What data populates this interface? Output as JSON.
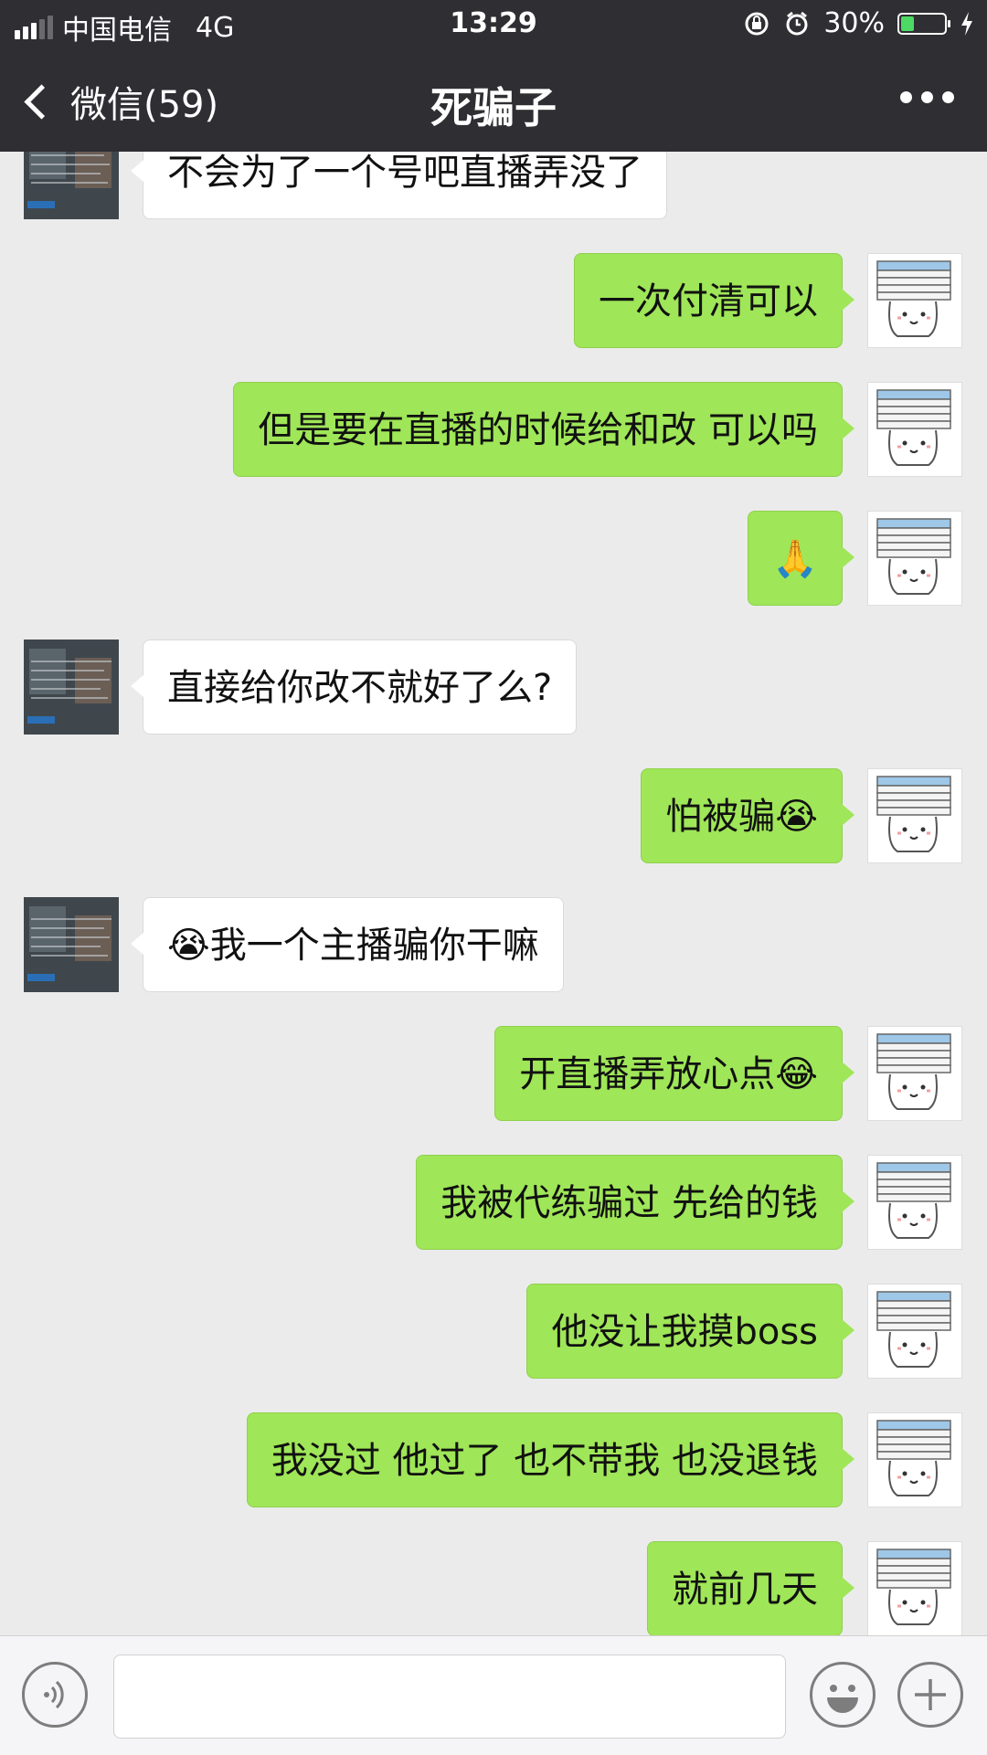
{
  "status_bar": {
    "carrier": "中国电信",
    "network": "4G",
    "time": "13:29",
    "battery_percent": "30%",
    "battery_level": 0.3
  },
  "nav": {
    "back_label": "微信(59)",
    "title": "死骗子",
    "more_icon": "more-dots-icon"
  },
  "messages": [
    {
      "from": "other",
      "text": "不会为了一个号吧直播弄没了"
    },
    {
      "from": "me",
      "text": "一次付清可以"
    },
    {
      "from": "me",
      "text": "但是要在直播的时候给和改 可以吗"
    },
    {
      "from": "me",
      "text": "🙏"
    },
    {
      "from": "other",
      "text": "直接给你改不就好了么?"
    },
    {
      "from": "me",
      "text": "怕被骗😭"
    },
    {
      "from": "other",
      "text": "😭我一个主播骗你干嘛"
    },
    {
      "from": "me",
      "text": "开直播弄放心点😂"
    },
    {
      "from": "me",
      "text": "我被代练骗过 先给的钱"
    },
    {
      "from": "me",
      "text": "他没让我摸boss"
    },
    {
      "from": "me",
      "text": "我没过 他过了 也不带我 也没退钱"
    },
    {
      "from": "me",
      "text": "就前几天"
    }
  ],
  "input_bar": {
    "voice_icon": "voice-icon",
    "emoji_icon": "emoji-icon",
    "plus_icon": "plus-icon",
    "text_value": ""
  },
  "colors": {
    "header_bg": "#2e2e33",
    "chat_bg": "#ebebeb",
    "my_bubble": "#9fe658",
    "other_bubble": "#ffffff"
  }
}
